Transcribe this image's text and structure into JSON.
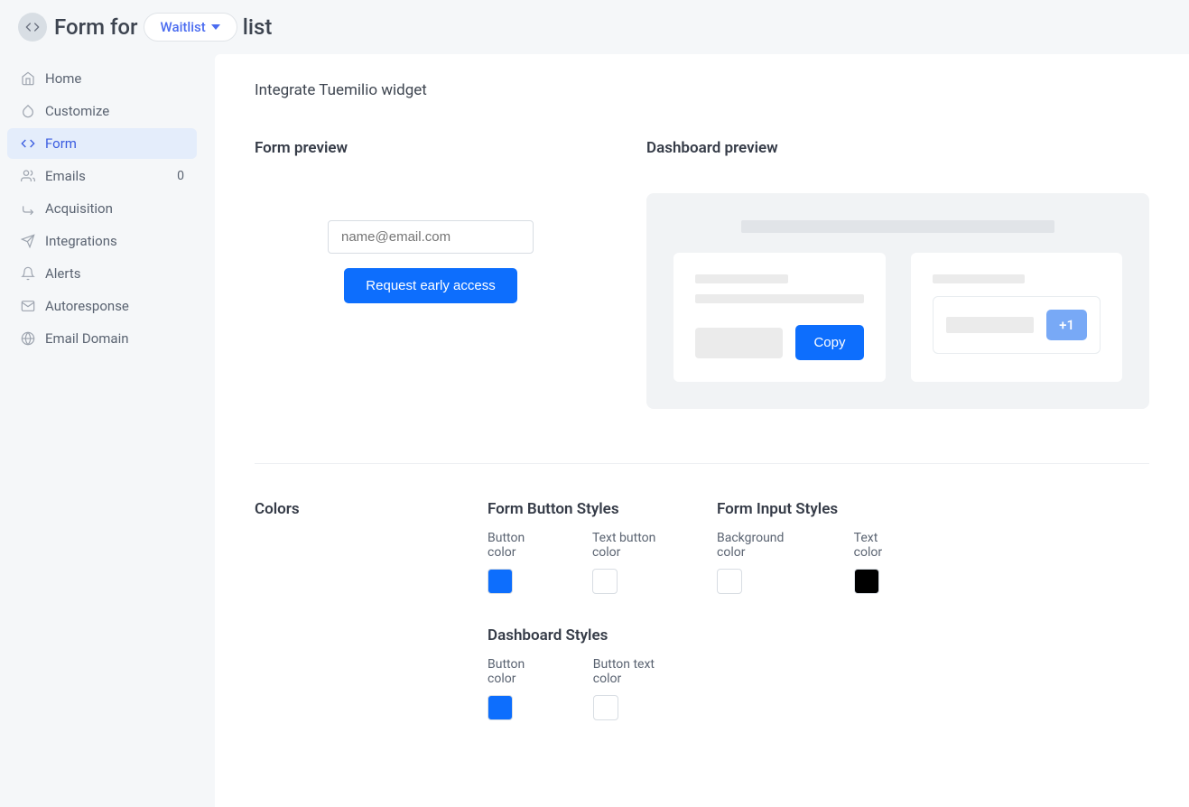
{
  "header": {
    "title_prefix": "Form for",
    "dropdown_label": "Waitlist",
    "title_suffix": "list"
  },
  "sidebar": {
    "items": [
      {
        "label": "Home",
        "icon": "home-icon",
        "active": false
      },
      {
        "label": "Customize",
        "icon": "droplet-icon",
        "active": false
      },
      {
        "label": "Form",
        "icon": "code-icon",
        "active": true
      },
      {
        "label": "Emails",
        "icon": "users-icon",
        "active": false,
        "badge": "0"
      },
      {
        "label": "Acquisition",
        "icon": "arrow-reply-icon",
        "active": false
      },
      {
        "label": "Integrations",
        "icon": "send-icon",
        "active": false
      },
      {
        "label": "Alerts",
        "icon": "bell-icon",
        "active": false
      },
      {
        "label": "Autoresponse",
        "icon": "mail-icon",
        "active": false
      },
      {
        "label": "Email Domain",
        "icon": "globe-icon",
        "active": false
      }
    ]
  },
  "main": {
    "title": "Integrate Tuemilio widget",
    "form_preview": {
      "heading": "Form preview",
      "email_placeholder": "name@email.com",
      "button_label": "Request early access"
    },
    "dashboard_preview": {
      "heading": "Dashboard preview",
      "copy_label": "Copy",
      "referral_badge": "+1"
    },
    "colors": {
      "heading": "Colors",
      "form_button_styles": {
        "heading": "Form Button Styles",
        "items": [
          {
            "label": "Button color",
            "color": "#0d6efd"
          },
          {
            "label": "Text button color",
            "color": "#ffffff"
          }
        ]
      },
      "form_input_styles": {
        "heading": "Form Input Styles",
        "items": [
          {
            "label": "Background color",
            "color": "#ffffff"
          },
          {
            "label": "Text color",
            "color": "#000000"
          }
        ]
      },
      "dashboard_styles": {
        "heading": "Dashboard Styles",
        "items": [
          {
            "label": "Button color",
            "color": "#0d6efd"
          },
          {
            "label": "Button text color",
            "color": "#ffffff"
          }
        ]
      }
    }
  }
}
